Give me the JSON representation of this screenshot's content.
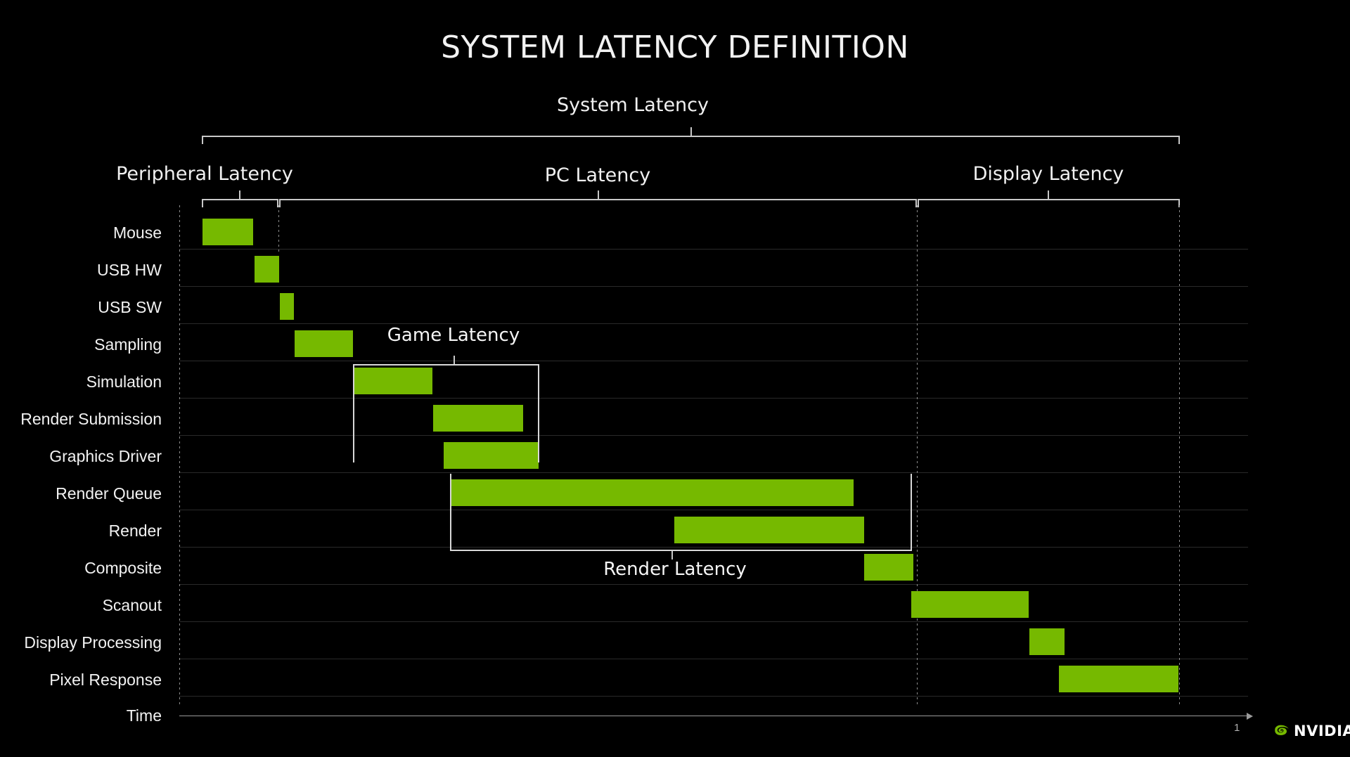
{
  "slide": {
    "title": "SYSTEM LATENCY DEFINITION",
    "page_number": "1",
    "brand": "NVIDIA",
    "background_color": "#000000",
    "accent_color": "#76b900",
    "line_color": "#c8c8c8"
  },
  "groups": {
    "system": "System Latency",
    "peripheral": "Peripheral Latency",
    "pc": "PC Latency",
    "display": "Display Latency",
    "game": "Game Latency",
    "render": "Render Latency"
  },
  "axis": {
    "time_label": "Time"
  },
  "chart_data": {
    "type": "bar",
    "title": "SYSTEM LATENCY DEFINITION",
    "xlabel": "Time",
    "ylabel": "",
    "orientation": "horizontal",
    "grid": true,
    "legend": "none",
    "note": "Waterfall / Gantt-style timeline of latency stages; x positions are relative time units (0-100 across the System Latency span).",
    "xlim": [
      0,
      100
    ],
    "categories": [
      "Mouse",
      "USB HW",
      "USB SW",
      "Sampling",
      "Simulation",
      "Render Submission",
      "Graphics Driver",
      "Render Queue",
      "Render",
      "Composite",
      "Scanout",
      "Display Processing",
      "Pixel Response"
    ],
    "segments": [
      {
        "label": "Mouse",
        "start": 0.0,
        "end": 5.2,
        "duration": 5.2
      },
      {
        "label": "USB HW",
        "start": 5.3,
        "end": 7.8,
        "duration": 2.5
      },
      {
        "label": "USB SW",
        "start": 7.9,
        "end": 9.3,
        "duration": 1.4
      },
      {
        "label": "Sampling",
        "start": 9.4,
        "end": 15.4,
        "duration": 6.0
      },
      {
        "label": "Simulation",
        "start": 15.5,
        "end": 23.6,
        "duration": 8.1
      },
      {
        "label": "Render Submission",
        "start": 23.6,
        "end": 32.8,
        "duration": 9.2
      },
      {
        "label": "Graphics Driver",
        "start": 24.7,
        "end": 34.4,
        "duration": 9.7
      },
      {
        "label": "Render Queue",
        "start": 25.4,
        "end": 66.6,
        "duration": 41.2
      },
      {
        "label": "Render",
        "start": 48.2,
        "end": 67.7,
        "duration": 19.5
      },
      {
        "label": "Composite",
        "start": 67.7,
        "end": 72.7,
        "duration": 5.0
      },
      {
        "label": "Scanout",
        "start": 72.5,
        "end": 84.5,
        "duration": 12.0
      },
      {
        "label": "Display Processing",
        "start": 84.6,
        "end": 88.2,
        "duration": 3.6
      },
      {
        "label": "Pixel Response",
        "start": 87.8,
        "end": 100.0,
        "duration": 12.2
      }
    ],
    "groups": [
      {
        "name": "System Latency",
        "start": 0.0,
        "end": 100.0
      },
      {
        "name": "Peripheral Latency",
        "start": 0.0,
        "end": 7.8
      },
      {
        "name": "PC Latency",
        "start": 7.9,
        "end": 73.0
      },
      {
        "name": "Display Latency",
        "start": 73.2,
        "end": 100.0
      },
      {
        "name": "Game Latency",
        "start": 15.5,
        "end": 34.5
      },
      {
        "name": "Render Latency",
        "start": 25.4,
        "end": 72.4
      }
    ]
  },
  "rows": [
    {
      "label": "Mouse"
    },
    {
      "label": "USB HW"
    },
    {
      "label": "USB SW"
    },
    {
      "label": "Sampling"
    },
    {
      "label": "Simulation"
    },
    {
      "label": "Render Submission"
    },
    {
      "label": "Graphics Driver"
    },
    {
      "label": "Render Queue"
    },
    {
      "label": "Render"
    },
    {
      "label": "Composite"
    },
    {
      "label": "Scanout"
    },
    {
      "label": "Display Processing"
    },
    {
      "label": "Pixel Response"
    }
  ]
}
